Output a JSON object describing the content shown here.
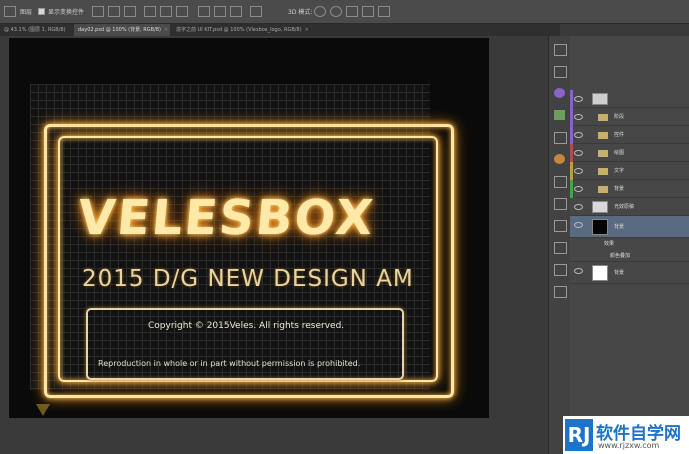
{
  "options_bar": {
    "zoom_status": "® 43.1% (图层 1, RGB/8)",
    "show_transform_controls": "显示变换控件",
    "auto_select_value": "图层",
    "mode_3d": "3D 模式:"
  },
  "tabs": [
    {
      "label": "@ 43.1% (图层 1, RGB/8)"
    },
    {
      "label": "day02.psd @ 100% (背景, RGB/8)"
    },
    {
      "label": "造字之前 UI KIT.psd @ 100% (Vlesbox_logo, RGB/8)"
    }
  ],
  "artwork": {
    "title": "VELESBOX",
    "subtitle": "2015 D/G   NEW DESIGN AM",
    "copyright": "Copyright © 2015Veles. All rights reserved.",
    "notice": "Reproduction in whole or in part without permission is prohibited."
  },
  "layers": [
    {
      "name": "",
      "color": "#8a63c9",
      "kind": "thumb"
    },
    {
      "name": "阶段",
      "color": "#8a63c9",
      "kind": "folder"
    },
    {
      "name": "控件",
      "color": "#8a63c9",
      "kind": "folder"
    },
    {
      "name": "绘图",
      "color": "#b34a4a",
      "kind": "folder"
    },
    {
      "name": "文字",
      "color": "#b3a33a",
      "kind": "folder"
    },
    {
      "name": "背景",
      "color": "#4aa34a",
      "kind": "folder"
    },
    {
      "name": "光效原稿",
      "color": "",
      "kind": "thumb"
    },
    {
      "name": "背景",
      "color": "",
      "kind": "thumb",
      "selected": true
    },
    {
      "name": "效果",
      "color": "",
      "kind": "effect"
    },
    {
      "name": "颜色叠加",
      "color": "",
      "kind": "effect"
    },
    {
      "name": "背景",
      "color": "",
      "kind": "white"
    }
  ],
  "watermark": {
    "badge": "RJ",
    "title": "软件自学网",
    "url": "www.rjzxw.com"
  }
}
